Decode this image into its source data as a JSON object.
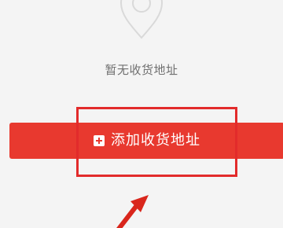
{
  "empty_state": {
    "icon": "location-pin-icon",
    "text": "暂无收货地址"
  },
  "add_address": {
    "icon": "plus-square-icon",
    "label": "添加收货地址"
  },
  "annotation": {
    "highlight_color": "#e22b2b",
    "arrow_icon": "pointer-arrow-icon"
  },
  "colors": {
    "accent": "#e8392f",
    "background": "#f4f4f4",
    "muted_text": "#707070"
  }
}
